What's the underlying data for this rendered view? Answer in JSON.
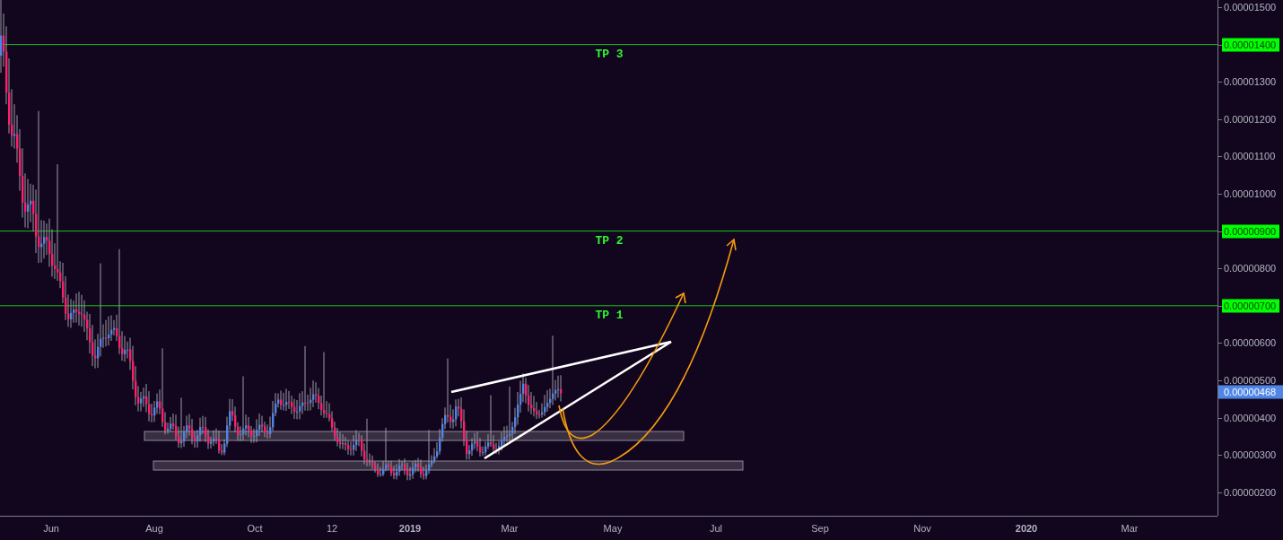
{
  "chart": {
    "targets": [
      {
        "label": "TP 3"
      },
      {
        "label": "TP 2"
      },
      {
        "label": "TP 1"
      }
    ]
  },
  "price_axis": {
    "ticks": [
      {
        "label": "0.00001500",
        "highlighted": false
      },
      {
        "label": "0.00001400",
        "highlighted": true
      },
      {
        "label": "0.00001300",
        "highlighted": false
      },
      {
        "label": "0.00001200",
        "highlighted": false
      },
      {
        "label": "0.00001100",
        "highlighted": false
      },
      {
        "label": "0.00001000",
        "highlighted": false
      },
      {
        "label": "0.00000900",
        "highlighted": true
      },
      {
        "label": "0.00000800",
        "highlighted": false
      },
      {
        "label": "0.00000700",
        "highlighted": true
      },
      {
        "label": "0.00000600",
        "highlighted": false
      },
      {
        "label": "0.00000500",
        "highlighted": false
      },
      {
        "label": "0.00000400",
        "highlighted": false
      },
      {
        "label": "0.00000300",
        "highlighted": false
      },
      {
        "label": "0.00000200",
        "highlighted": false
      }
    ],
    "current_price": {
      "label": "0.00000468"
    }
  },
  "time_axis": {
    "ticks": [
      {
        "label": "Jun",
        "bold": false
      },
      {
        "label": "Aug",
        "bold": false
      },
      {
        "label": "Oct",
        "bold": false
      },
      {
        "label": "12",
        "bold": false
      },
      {
        "label": "2019",
        "bold": true
      },
      {
        "label": "Mar",
        "bold": false
      },
      {
        "label": "May",
        "bold": false
      },
      {
        "label": "Jul",
        "bold": false
      },
      {
        "label": "Sep",
        "bold": false
      },
      {
        "label": "Nov",
        "bold": false
      },
      {
        "label": "2020",
        "bold": true
      },
      {
        "label": "Mar",
        "bold": false
      }
    ]
  }
}
